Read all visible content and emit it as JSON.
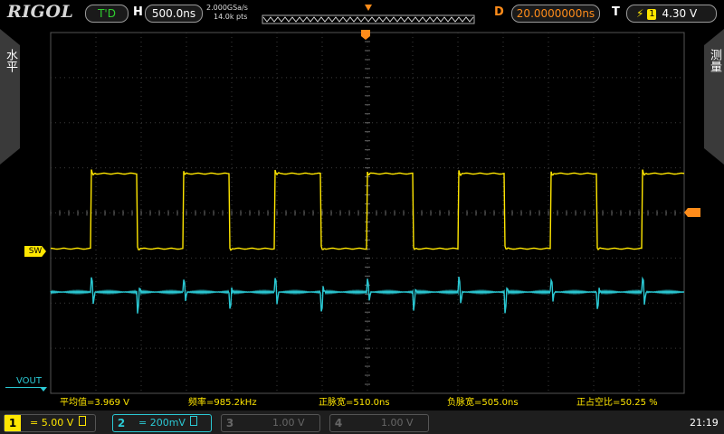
{
  "header": {
    "brand": "RIGOL",
    "trigger_status": "T'D",
    "h_label": "H",
    "timebase": "500.0ns",
    "sample_rate": "2.000GSa/s",
    "memory_depth": "14.0k pts",
    "d_label": "D",
    "delay": "20.0000000ns",
    "t_label": "T",
    "trigger_source": "1",
    "trigger_level": "4.30 V"
  },
  "side_tabs": {
    "left": "水平",
    "right": "测量"
  },
  "markers": {
    "ch1_label": "SW",
    "ch2_label": "VOUT"
  },
  "measurements": [
    {
      "label": "平均值=3.969 V"
    },
    {
      "label": "频率=985.2kHz"
    },
    {
      "label": "正脉宽=510.0ns"
    },
    {
      "label": "负脉宽=505.0ns"
    },
    {
      "label": "正占空比=50.25 %"
    }
  ],
  "channels": [
    {
      "num": "1",
      "coupling": "=",
      "scale": "5.00 V",
      "color": "#ffe600",
      "active": true
    },
    {
      "num": "2",
      "coupling": "=",
      "scale": "200mV",
      "color": "#2bc9d4",
      "active": true
    },
    {
      "num": "3",
      "coupling": "",
      "scale": "1.00 V",
      "color": "#666666",
      "active": false
    },
    {
      "num": "4",
      "coupling": "",
      "scale": "1.00 V",
      "color": "#666666",
      "active": false
    }
  ],
  "clock": "21:19",
  "colors": {
    "ch1": "#ffe600",
    "ch2": "#2bc9d4",
    "trigger": "#ff8c1a",
    "grid": "#3c3c3c"
  },
  "waveform": {
    "period_us": 1.015,
    "ch1_high_div": 1.8,
    "ch1_low_div": 0.05,
    "ch2_offset_div": -1.0
  }
}
